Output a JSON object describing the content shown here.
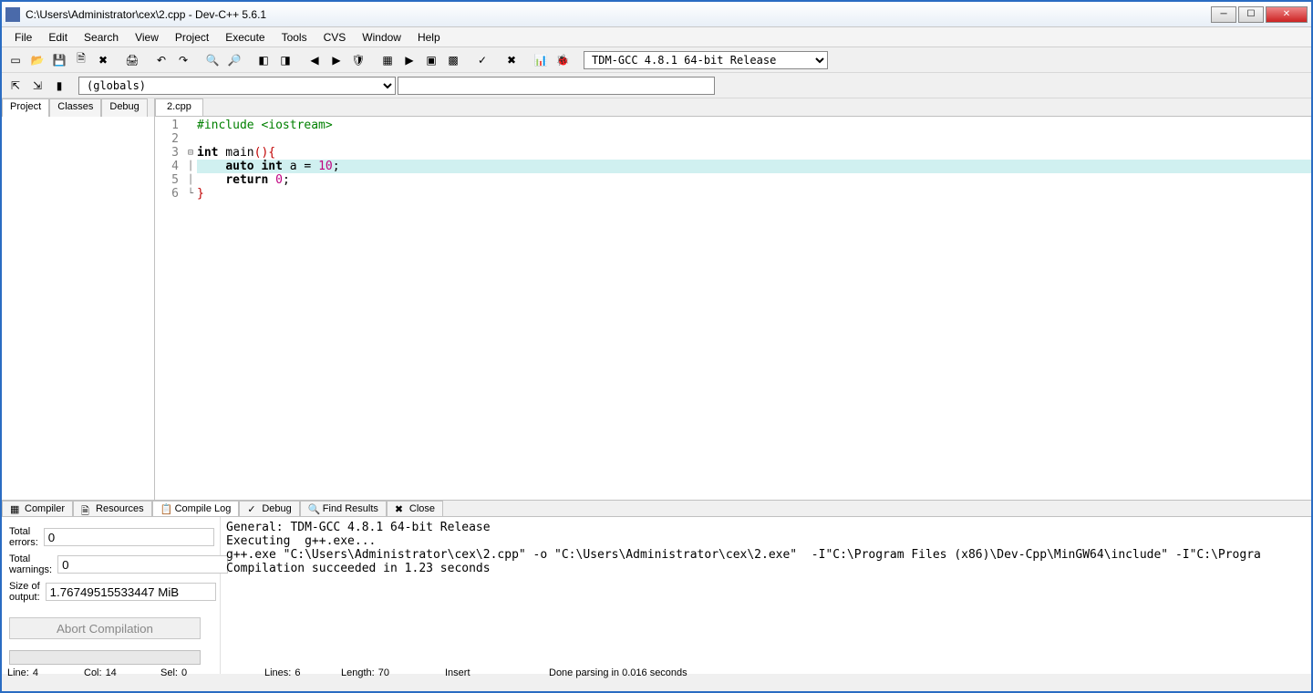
{
  "title": "C:\\Users\\Administrator\\cex\\2.cpp - Dev-C++ 5.6.1",
  "menus": [
    "File",
    "Edit",
    "Search",
    "View",
    "Project",
    "Execute",
    "Tools",
    "CVS",
    "Window",
    "Help"
  ],
  "compiler_select": "TDM-GCC 4.8.1 64-bit Release",
  "globals_select": "(globals)",
  "left_tabs": [
    "Project",
    "Classes",
    "Debug"
  ],
  "editor_tabs": {
    "active": "2.cpp"
  },
  "code": {
    "lines": [
      {
        "n": 1,
        "seg": [
          {
            "t": "#include <iostream>",
            "c": "pp"
          }
        ]
      },
      {
        "n": 2,
        "seg": []
      },
      {
        "n": 3,
        "fold": "⊟",
        "seg": [
          {
            "t": "int",
            "c": "kw"
          },
          {
            "t": " main"
          },
          {
            "t": "()",
            "c": "str-brace"
          },
          {
            "t": "{",
            "c": "str-brace"
          }
        ]
      },
      {
        "n": 4,
        "hl": true,
        "bar": true,
        "seg": [
          {
            "t": "    "
          },
          {
            "t": "auto",
            "c": "kw"
          },
          {
            "t": " "
          },
          {
            "t": "int",
            "c": "kw"
          },
          {
            "t": " a "
          },
          {
            "t": "="
          },
          {
            "t": " "
          },
          {
            "t": "10",
            "c": "num"
          },
          {
            "t": ";"
          }
        ]
      },
      {
        "n": 5,
        "bar": true,
        "seg": [
          {
            "t": "    "
          },
          {
            "t": "return",
            "c": "kw"
          },
          {
            "t": " "
          },
          {
            "t": "0",
            "c": "num"
          },
          {
            "t": ";"
          }
        ]
      },
      {
        "n": 6,
        "end": true,
        "seg": [
          {
            "t": "}",
            "c": "str-brace"
          }
        ]
      }
    ]
  },
  "bottom_tabs": [
    "Compiler",
    "Resources",
    "Compile Log",
    "Debug",
    "Find Results",
    "Close"
  ],
  "bottom_active": 2,
  "stats": {
    "total_errors_label": "Total errors:",
    "total_errors": "0",
    "total_warnings_label": "Total warnings:",
    "total_warnings": "0",
    "size_label": "Size of output:",
    "size": "1.76749515533447 MiB",
    "abort": "Abort Compilation"
  },
  "log": "General: TDM-GCC 4.8.1 64-bit Release\nExecuting  g++.exe...\ng++.exe \"C:\\Users\\Administrator\\cex\\2.cpp\" -o \"C:\\Users\\Administrator\\cex\\2.exe\"  -I\"C:\\Program Files (x86)\\Dev-Cpp\\MinGW64\\include\" -I\"C:\\Progra\nCompilation succeeded in 1.23 seconds",
  "status": {
    "line_label": "Line:",
    "line": "4",
    "col_label": "Col:",
    "col": "14",
    "sel_label": "Sel:",
    "sel": "0",
    "lines_label": "Lines:",
    "lines": "6",
    "length_label": "Length:",
    "length": "70",
    "insert": "Insert",
    "parse": "Done parsing in 0.016 seconds"
  },
  "toolbar_icons": [
    "new",
    "open",
    "save",
    "saveall",
    "close-file",
    "sep",
    "print",
    "sep",
    "undo",
    "redo",
    "sep",
    "find",
    "replace",
    "sep",
    "toggle-bm",
    "goto-bm",
    "sep",
    "back",
    "fwd",
    "shield",
    "sep",
    "compile",
    "run",
    "compile-run",
    "rebuild",
    "sep",
    "syntax",
    "sep",
    "stop",
    "sep",
    "profile",
    "debug-ico"
  ],
  "toolbar2_icons": [
    "insert-file",
    "goto",
    "bookmarks",
    "sep"
  ]
}
